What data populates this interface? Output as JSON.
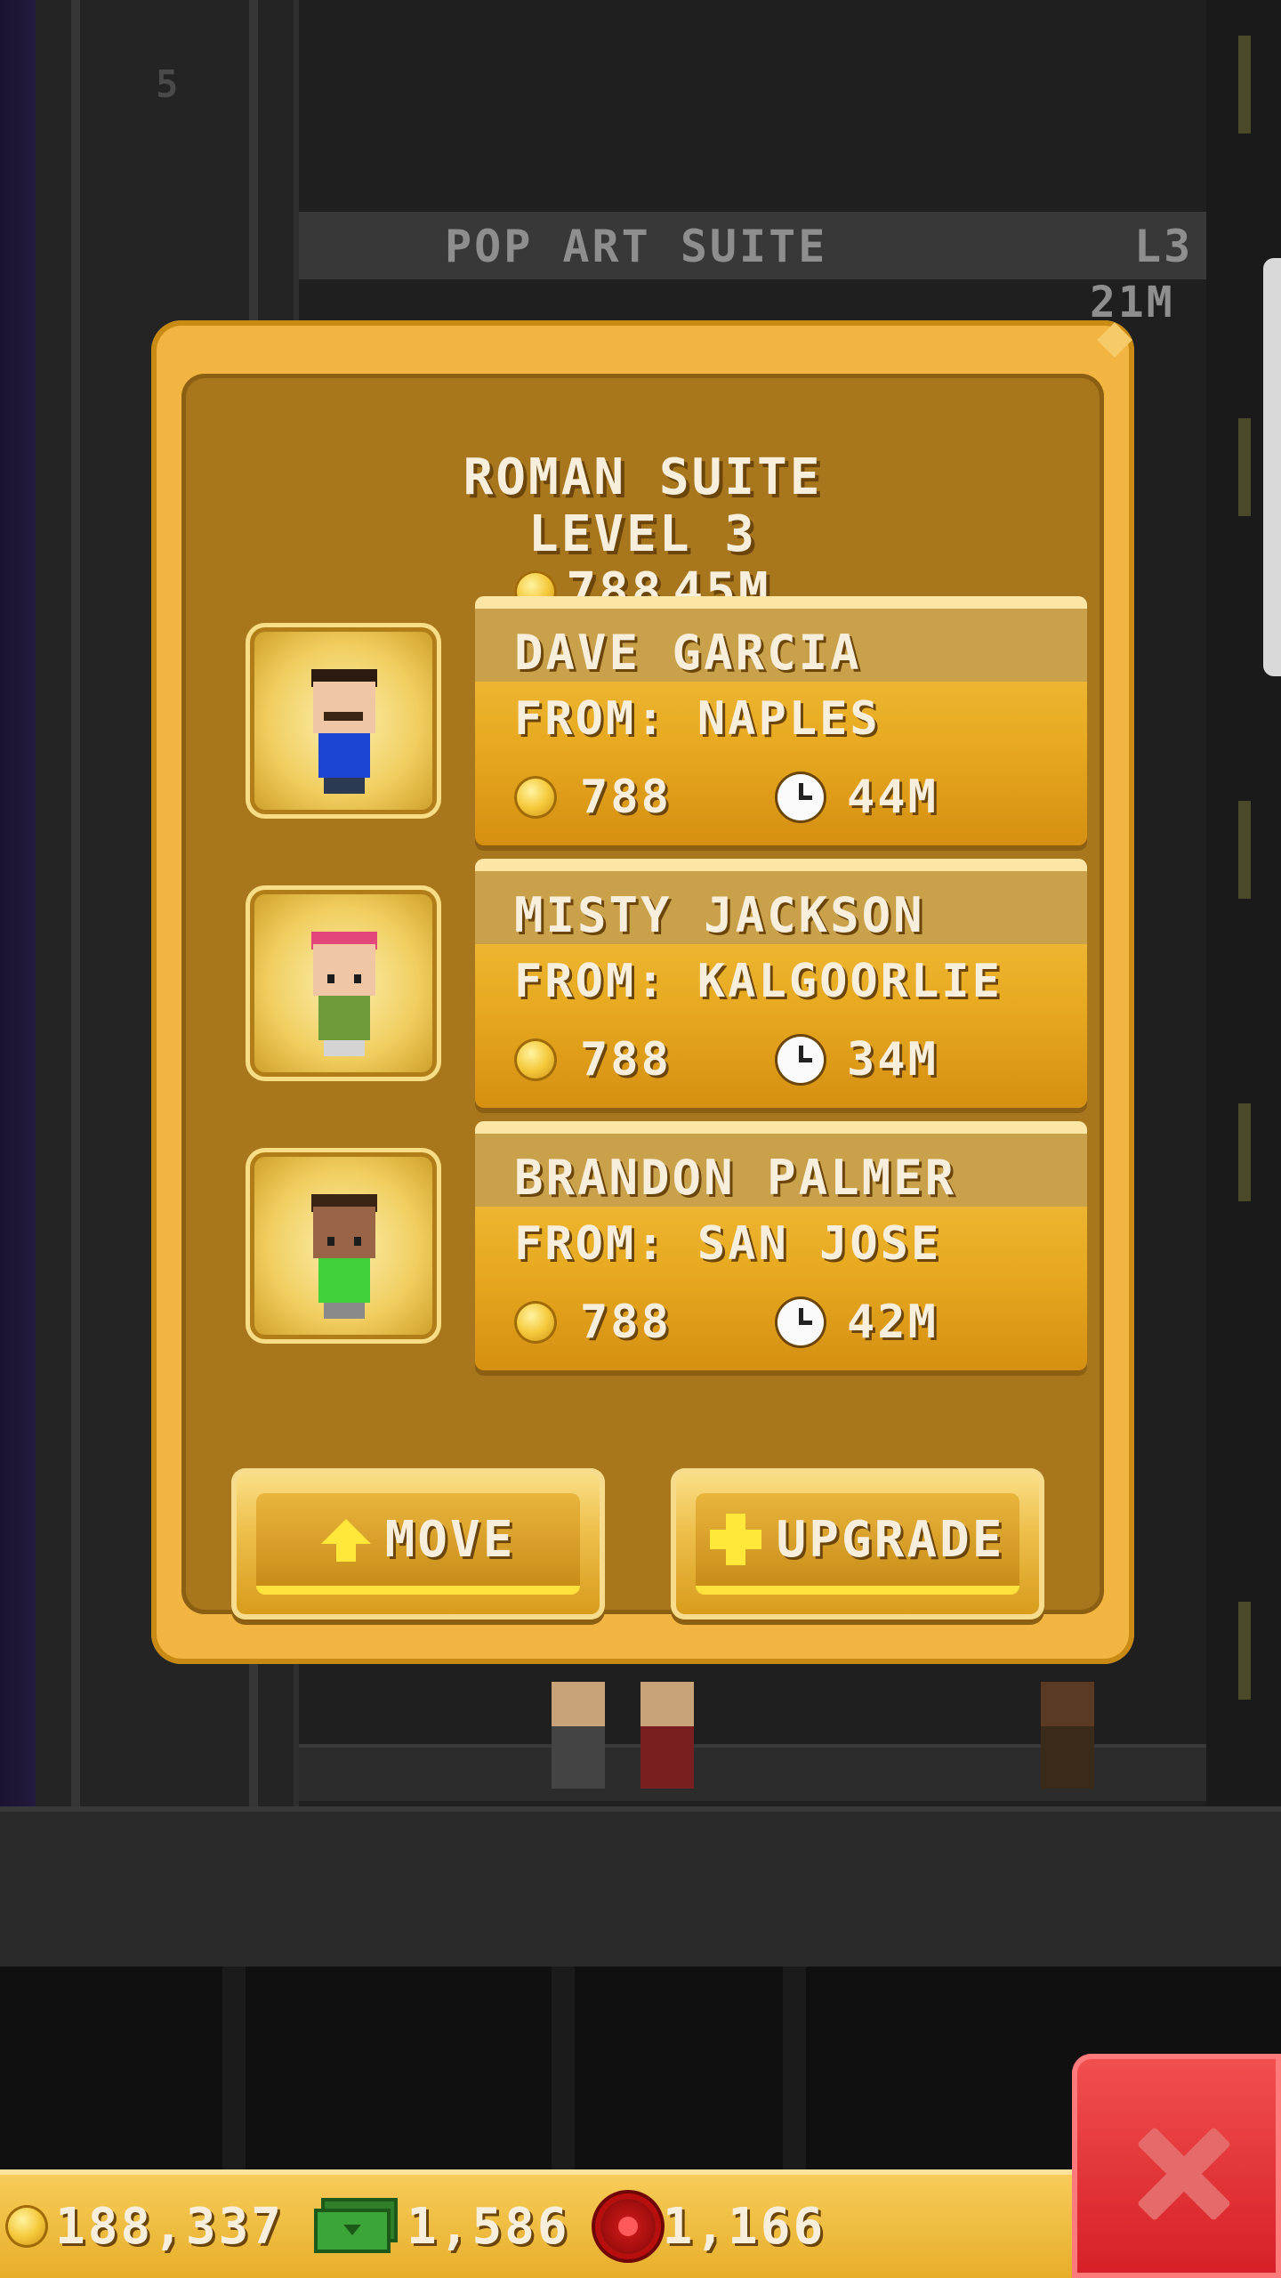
{
  "background": {
    "shaft_floor_number": "5",
    "room_above_name": "POP ART SUITE",
    "room_above_level": "L3",
    "room_above_timer": "21M"
  },
  "panel": {
    "room_name": "ROMAN SUITE",
    "level_label": "LEVEL 3",
    "rent": "788",
    "time": "45M"
  },
  "residents": [
    {
      "name": "DAVE GARCIA",
      "from": "FROM: NAPLES",
      "rent": "788",
      "time": "44M",
      "hair_color": "#2a1a10",
      "skin_color": "#f1c6a4",
      "shirt_color": "#1e44d6",
      "has_mustache": true
    },
    {
      "name": "MISTY JACKSON",
      "from": "FROM: KALGOORLIE",
      "rent": "788",
      "time": "34M",
      "hair_color": "#e2467a",
      "skin_color": "#f1c6a4",
      "shirt_color": "#6f9a3a",
      "has_mustache": false
    },
    {
      "name": "BRANDON PALMER",
      "from": "FROM: SAN JOSE",
      "rent": "788",
      "time": "42M",
      "hair_color": "#3a2414",
      "skin_color": "#9a6446",
      "shirt_color": "#41d13a",
      "has_mustache": false
    }
  ],
  "buttons": {
    "move_label": "MOVE",
    "upgrade_label": "UPGRADE"
  },
  "hud": {
    "coins": "188,337",
    "bux": "1,586",
    "tokens": "1,166"
  },
  "icons": {
    "coin": "coin-icon",
    "clock": "clock-icon",
    "move": "arrow-up-icon",
    "upgrade": "plus-icon",
    "bux": "tower-bux-icon",
    "token": "golden-ticket-icon",
    "close": "close-icon"
  },
  "colors": {
    "panel_gold": "#f2b542",
    "panel_inner": "#a8761d",
    "close_red": "#d61f26",
    "arrow_yellow": "#ffe83a"
  }
}
